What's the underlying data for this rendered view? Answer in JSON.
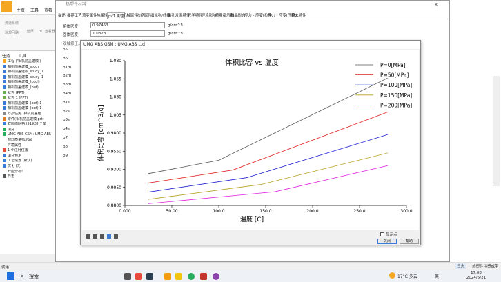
{
  "app": {
    "menu_tabs": [
      "主页",
      "工具",
      "查看"
    ],
    "window_title": "热塑性材料"
  },
  "ribbon": {
    "buttons": [
      "流道系统",
      "冷却回路",
      "壁厚",
      "3D 查看器"
    ]
  },
  "left_panel": {
    "tabs": [
      "任务",
      "工具"
    ],
    "tree": [
      {
        "label": "工程 ('相机前盖建模')",
        "icon_color": "#f5a623"
      },
      {
        "label": "相机前盖建模_study",
        "icon_color": "#3a7bd5"
      },
      {
        "label": "相机前盖建模_study_1",
        "icon_color": "#3a7bd5"
      },
      {
        "label": "相机前盖建模_study_1",
        "icon_color": "#3a7bd5"
      },
      {
        "label": "相机前盖建模_(cool)",
        "icon_color": "#3a7bd5"
      },
      {
        "label": "相机前盖建模_(but)",
        "icon_color": "#3a7bd5"
      },
      {
        "label": "就告 (PPT)",
        "icon_color": "#6ab04c"
      },
      {
        "label": "就告 1 (PPT)",
        "icon_color": "#6ab04c"
      },
      {
        "label": "相机前盖建模_(but) 1",
        "icon_color": "#3a7bd5"
      },
      {
        "label": "相机前盖建模_(but) 1",
        "icon_color": "#3a7bd5"
      },
      {
        "label": "方案任务 (相机前盖建...",
        "icon_color": "#888"
      },
      {
        "label": "零件(相机前盖建模.prt)",
        "icon_color": "#e67e22"
      },
      {
        "label": "双层面网格 (51928 个单",
        "icon_color": "#3a7bd5"
      },
      {
        "label": "填充",
        "icon_color": "#27ae60"
      },
      {
        "label": "UMG ABS GSM: UMG ABS",
        "icon_color": "#27ae60"
      },
      {
        "label": "材料质量指示器",
        "icon_color": "#fff"
      },
      {
        "label": "环境属性",
        "icon_color": "#fff"
      },
      {
        "label": "1 个注射位置",
        "icon_color": "#e74c3c"
      },
      {
        "label": "填充预定",
        "icon_color": "#3a7bd5"
      },
      {
        "label": "工艺设置 (默认)",
        "icon_color": "#3a7bd5"
      },
      {
        "label": "优化 (无)",
        "icon_color": "#3a7bd5"
      },
      {
        "label": "开始分析!",
        "icon_color": "#fff"
      },
      {
        "label": "日志",
        "icon_color": "#555"
      }
    ]
  },
  "props": {
    "tabs": [
      "描述",
      "推荐工艺",
      "流变属性",
      "热属性",
      "pvT 属性",
      "机械属性",
      "收缩属性",
      "填充物/纤维",
      "微孔发泡特性",
      "光学特性",
      "环境影响",
      "质量指示器",
      "结晶形态",
      "应力 - 应变(拉伸)",
      "应力 - 应变(压缩)",
      "粉末特性"
    ],
    "active_tab": "pvT 属性",
    "melt_density_label": "熔体密度",
    "melt_density_value": "0.97453",
    "melt_density_unit": "g/cm^3",
    "solid_density_label": "固体密度",
    "solid_density_value": "1.0828",
    "solid_density_unit": "g/cm^3",
    "section_label": "双域修正...",
    "row_labels": [
      "b5",
      "b6",
      "b1m",
      "b2m",
      "b3m",
      "b4m",
      "b1s",
      "b2s",
      "b3s",
      "b4s",
      "b7",
      "b8",
      "b9"
    ]
  },
  "dialog": {
    "title": "UMG ABS GSM : UMG ABS Ltd",
    "show_points_label": "显示点",
    "close_label": "关闭",
    "help_label": "帮助"
  },
  "chart_data": {
    "type": "line",
    "title": "体积比容 vs 温度",
    "xlabel": "温度 [C]",
    "ylabel": "体积比容 [cm^3/g]",
    "xlim": [
      0,
      300
    ],
    "ylim": [
      0.88,
      1.08
    ],
    "xticks": [
      "0.000",
      "50.00",
      "100.0",
      "150.0",
      "200.0",
      "250.0",
      "300.0"
    ],
    "yticks": [
      "0.8800",
      "0.9050",
      "0.9300",
      "0.9550",
      "0.9800",
      "1.005",
      "1.030",
      "1.055",
      "1.080"
    ],
    "legend_position": "top-right",
    "series": [
      {
        "name": "P=0[MPa]",
        "color": "#555555",
        "x": [
          25,
          100,
          280
        ],
        "y": [
          0.924,
          0.9425,
          1.056
        ]
      },
      {
        "name": "P=50[MPa]",
        "color": "#e02020",
        "x": [
          25,
          115,
          280
        ],
        "y": [
          0.911,
          0.929,
          1.009
        ]
      },
      {
        "name": "P=100[MPa]",
        "color": "#2020d0",
        "x": [
          25,
          130,
          280
        ],
        "y": [
          0.8985,
          0.9185,
          0.978
        ]
      },
      {
        "name": "P=150[MPa]",
        "color": "#b8a020",
        "x": [
          25,
          145,
          280
        ],
        "y": [
          0.8885,
          0.909,
          0.9525
        ]
      },
      {
        "name": "P=200[MPa]",
        "color": "#e020e0",
        "x": [
          25,
          160,
          280
        ],
        "y": [
          0.8825,
          0.899,
          0.935
        ]
      }
    ]
  },
  "statusbar": {
    "left_text": "就绪",
    "right_tab1": "日志",
    "right_tab2": "热塑性注塑成型"
  },
  "taskbar": {
    "search_label": "搜索",
    "weather": "17°C 多云",
    "lang": "英",
    "time": "17:08",
    "date": "2024/5/21"
  }
}
